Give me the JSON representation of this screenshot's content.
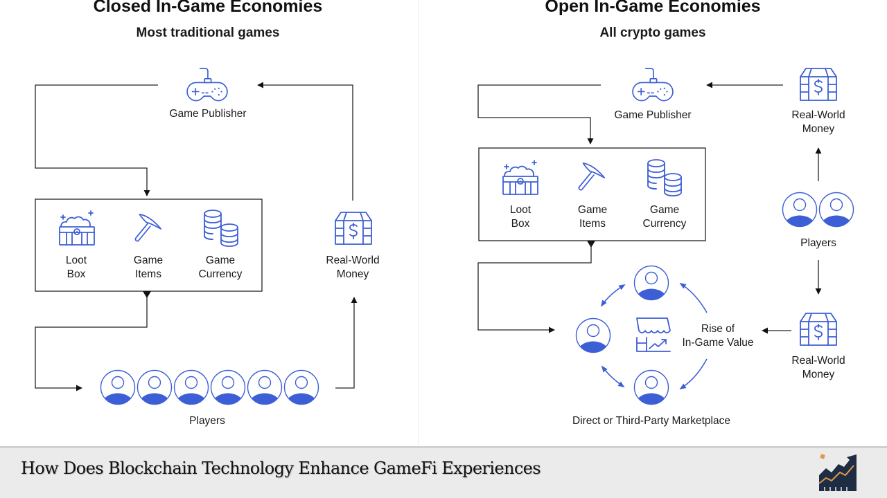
{
  "left": {
    "title": "Closed In-Game Economies",
    "subtitle": "Most traditional games",
    "publisher_label": "Game Publisher",
    "items": [
      {
        "line1": "Loot",
        "line2": "Box",
        "icon": "loot-box-icon"
      },
      {
        "line1": "Game",
        "line2": "Items",
        "icon": "pickaxe-icon"
      },
      {
        "line1": "Game",
        "line2": "Currency",
        "icon": "coins-icon"
      }
    ],
    "money_line1": "Real-World",
    "money_line2": "Money",
    "players_label": "Players",
    "player_count": 6
  },
  "right": {
    "title": "Open In-Game Economies",
    "subtitle": "All crypto games",
    "publisher_label": "Game Publisher",
    "items": [
      {
        "line1": "Loot",
        "line2": "Box",
        "icon": "loot-box-icon"
      },
      {
        "line1": "Game",
        "line2": "Items",
        "icon": "pickaxe-icon"
      },
      {
        "line1": "Game",
        "line2": "Currency",
        "icon": "coins-icon"
      }
    ],
    "money_top_line1": "Real-World",
    "money_top_line2": "Money",
    "players_label": "Players",
    "player_count": 2,
    "money_bottom_line1": "Real-World",
    "money_bottom_line2": "Money",
    "value_line1": "Rise of",
    "value_line2": "In-Game Value",
    "marketplace_label": "Direct or Third-Party Marketplace"
  },
  "footer": {
    "title": "How Does Blockchain Technology Enhance GameFi Experiences",
    "logo_icon": "growth-chart-logo-icon"
  },
  "colors": {
    "accent": "#3d5fd6",
    "line": "#222222",
    "footer_bg": "#ebebeb"
  }
}
